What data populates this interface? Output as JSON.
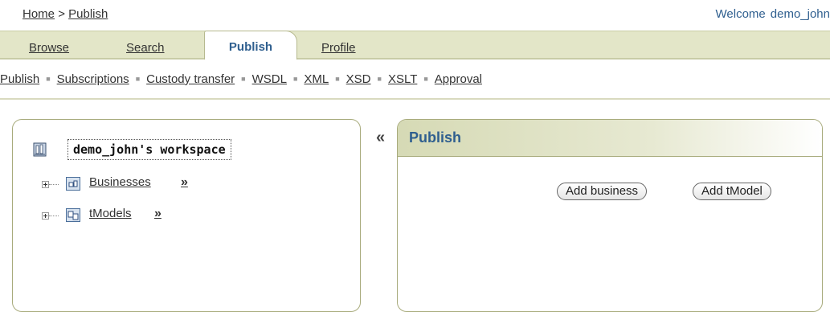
{
  "breadcrumb": {
    "home": "Home",
    "sep": ">",
    "current": "Publish"
  },
  "welcome": {
    "label": "Welcome",
    "user": "demo_john"
  },
  "tabs": [
    {
      "label": "Browse"
    },
    {
      "label": "Search"
    },
    {
      "label": "Publish",
      "active": true
    },
    {
      "label": "Profile"
    }
  ],
  "subnav": {
    "items": [
      "Publish",
      "Subscriptions",
      "Custody transfer",
      "WSDL",
      "XML",
      "XSD",
      "XSLT",
      "Approval"
    ],
    "separator": "■"
  },
  "tree": {
    "root": "demo_john's workspace",
    "nodes": [
      {
        "label": "Businesses",
        "more": "»"
      },
      {
        "label": "tModels",
        "more": "»"
      }
    ]
  },
  "collapse": "«",
  "publish_panel": {
    "title": "Publish",
    "buttons": {
      "add_business": "Add business",
      "add_tmodel": "Add tModel"
    }
  },
  "colors": {
    "accent": "#2f5f8f",
    "tab_bg": "#e3e6c8",
    "border": "#a8ab7c"
  }
}
